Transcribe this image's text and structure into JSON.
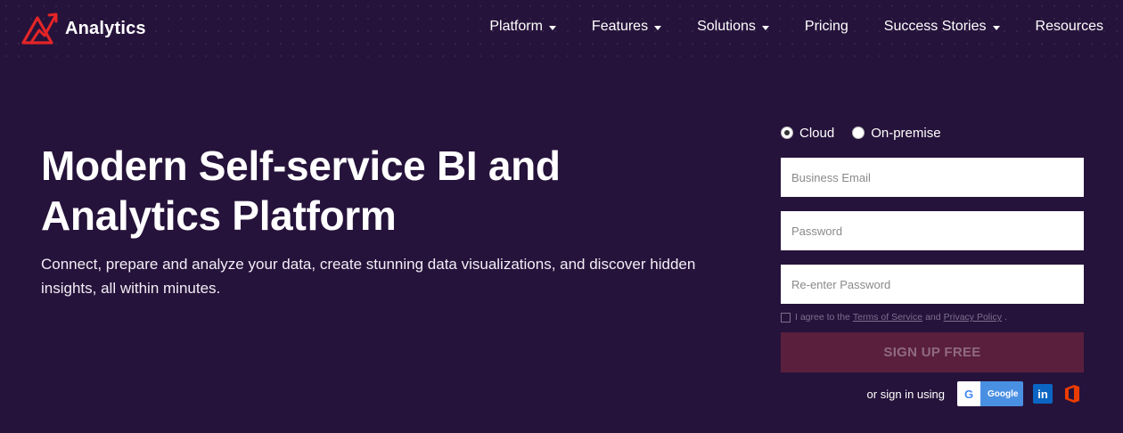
{
  "brand": {
    "name": "Analytics"
  },
  "nav": {
    "items": [
      {
        "label": "Platform",
        "dropdown": true
      },
      {
        "label": "Features",
        "dropdown": true
      },
      {
        "label": "Solutions",
        "dropdown": true
      },
      {
        "label": "Pricing",
        "dropdown": false
      },
      {
        "label": "Success Stories",
        "dropdown": true
      },
      {
        "label": "Resources",
        "dropdown": false
      }
    ]
  },
  "hero": {
    "title_line1": "Modern Self-service BI and",
    "title_line2": "Analytics Platform",
    "subtitle": "Connect, prepare and analyze your data, create stunning data visualizations, and discover hidden insights, all within minutes."
  },
  "signup": {
    "deploy_options": [
      {
        "label": "Cloud",
        "selected": true
      },
      {
        "label": "On-premise",
        "selected": false
      }
    ],
    "email_placeholder": "Business Email",
    "password_placeholder": "Password",
    "reenter_placeholder": "Re-enter Password",
    "terms_prefix": "I agree to the",
    "terms_link": "Terms of Service",
    "terms_and": "and",
    "privacy_link": "Privacy Policy",
    "terms_suffix": ".",
    "button_label": "SIGN UP FREE",
    "social_label": "or sign in using",
    "google_label": "Google",
    "google_letter": "G",
    "linkedin_label": "in"
  },
  "colors": {
    "background": "#26133b",
    "button": "#5a1f3d",
    "logo_accent": "#e42527"
  }
}
